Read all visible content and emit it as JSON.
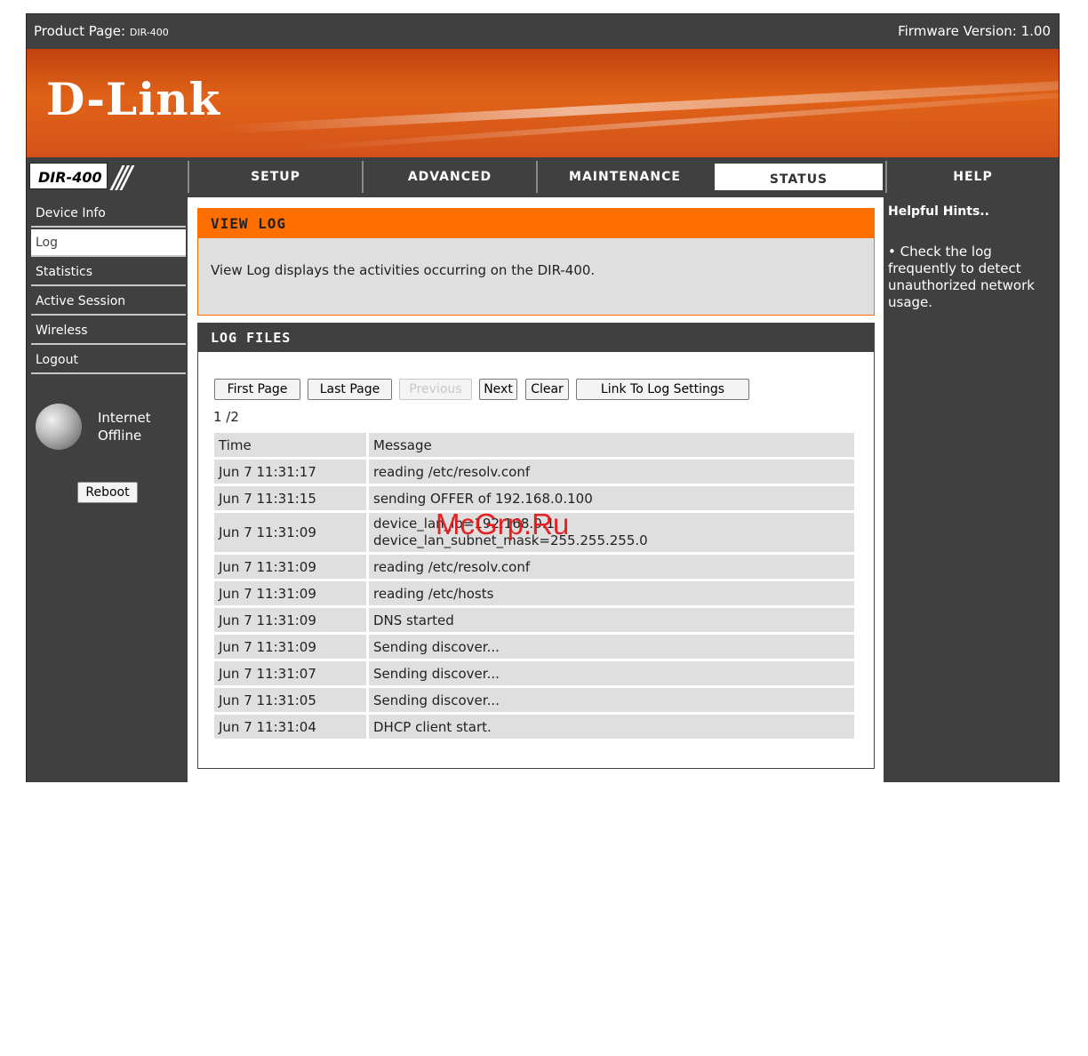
{
  "header": {
    "product_label": "Product Page: ",
    "product_model": "DIR-400",
    "firmware": "Firmware Version: 1.00"
  },
  "banner": {
    "logo_text": "D-Link"
  },
  "nav": {
    "model_badge": "DIR-400",
    "tabs": [
      "SETUP",
      "ADVANCED",
      "MAINTENANCE",
      "STATUS",
      "HELP"
    ],
    "active_tab": "STATUS"
  },
  "sidebar": {
    "items": [
      "Device Info",
      "Log",
      "Statistics",
      "Active Session",
      "Wireless",
      "Logout"
    ],
    "active_item": "Log",
    "status_line1": "Internet",
    "status_line2": "Offline",
    "reboot_label": "Reboot"
  },
  "view_log": {
    "title": "VIEW LOG",
    "description": "View Log displays the activities occurring on the DIR-400."
  },
  "log_files": {
    "title": "LOG FILES",
    "buttons": {
      "first": "First Page",
      "last": "Last Page",
      "previous": "Previous",
      "next": "Next",
      "clear": "Clear",
      "settings": "Link To Log Settings"
    },
    "page_info": "1 /2",
    "columns": [
      "Time",
      "Message"
    ],
    "rows": [
      {
        "time": "Jun 7 11:31:17",
        "message": "reading /etc/resolv.conf"
      },
      {
        "time": "Jun 7 11:31:15",
        "message": "sending OFFER of 192.168.0.100"
      },
      {
        "time": "Jun 7 11:31:09",
        "message": "device_lan_ip=192.168.0.1",
        "message2": "device_lan_subnet_mask=255.255.255.0"
      },
      {
        "time": "Jun 7 11:31:09",
        "message": "reading /etc/resolv.conf"
      },
      {
        "time": "Jun 7 11:31:09",
        "message": "reading /etc/hosts"
      },
      {
        "time": "Jun 7 11:31:09",
        "message": "DNS started"
      },
      {
        "time": "Jun 7 11:31:09",
        "message": "Sending discover..."
      },
      {
        "time": "Jun 7 11:31:07",
        "message": "Sending discover..."
      },
      {
        "time": "Jun 7 11:31:05",
        "message": "Sending discover..."
      },
      {
        "time": "Jun 7 11:31:04",
        "message": "DHCP client start."
      }
    ]
  },
  "help": {
    "title": "Helpful Hints..",
    "tip": "• Check the log frequently to detect unauthorized network usage."
  },
  "watermark": "McGrp.Ru"
}
